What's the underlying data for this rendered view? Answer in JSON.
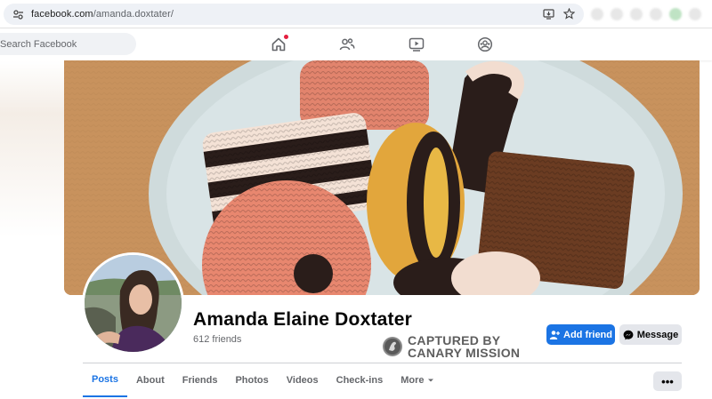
{
  "browser": {
    "url_host": "facebook.com",
    "url_path": "/amanda.doxtater/"
  },
  "nav": {
    "search_placeholder": "Search Facebook",
    "icons": [
      "home-icon",
      "friends-icon",
      "video-icon",
      "groups-icon"
    ],
    "home_has_notification": true
  },
  "profile": {
    "name": "Amanda Elaine Doxtater",
    "friends": "612 friends"
  },
  "watermark": {
    "line1": "CAPTURED BY",
    "line2": "CANARY MISSION"
  },
  "actions": {
    "add_friend": "Add friend",
    "message": "Message",
    "more": "•••"
  },
  "tabs": [
    {
      "label": "Posts",
      "active": true
    },
    {
      "label": "About"
    },
    {
      "label": "Friends"
    },
    {
      "label": "Photos"
    },
    {
      "label": "Videos"
    },
    {
      "label": "Check-ins"
    },
    {
      "label": "More"
    }
  ],
  "colors": {
    "brand_blue": "#1b74e4",
    "button_gray": "#e4e6eb",
    "notification_red": "#e41e3f"
  }
}
